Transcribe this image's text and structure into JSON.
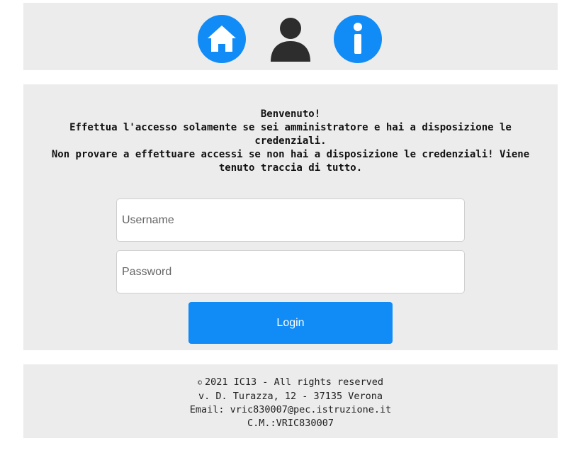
{
  "header": {
    "icons": [
      {
        "name": "home-icon",
        "color": "#118cf6"
      },
      {
        "name": "user-icon",
        "color": "#2d2d2d"
      },
      {
        "name": "info-icon",
        "color": "#118cf6"
      }
    ]
  },
  "intro": {
    "line1": "Benvenuto!",
    "line2": "Effettua l'accesso solamente se sei amministratore e hai a disposizione le credenziali.",
    "line3": "Non provare a effettuare accessi se non hai a disposizione le credenziali! Viene tenuto traccia di tutto."
  },
  "form": {
    "username_placeholder": "Username",
    "username_value": "",
    "password_placeholder": "Password",
    "password_value": "",
    "login_label": "Login",
    "login_color": "#118cf6"
  },
  "footer": {
    "copyright_symbol": "©",
    "copyright": "2021 IC13 - All rights reserved",
    "address": "v. D. Turazza, 12 - 37135 Verona",
    "email": "Email: vric830007@pec.istruzione.it",
    "cm": "C.M.:VRIC830007"
  },
  "colors": {
    "panel_background": "#ececec",
    "accent": "#118cf6"
  }
}
